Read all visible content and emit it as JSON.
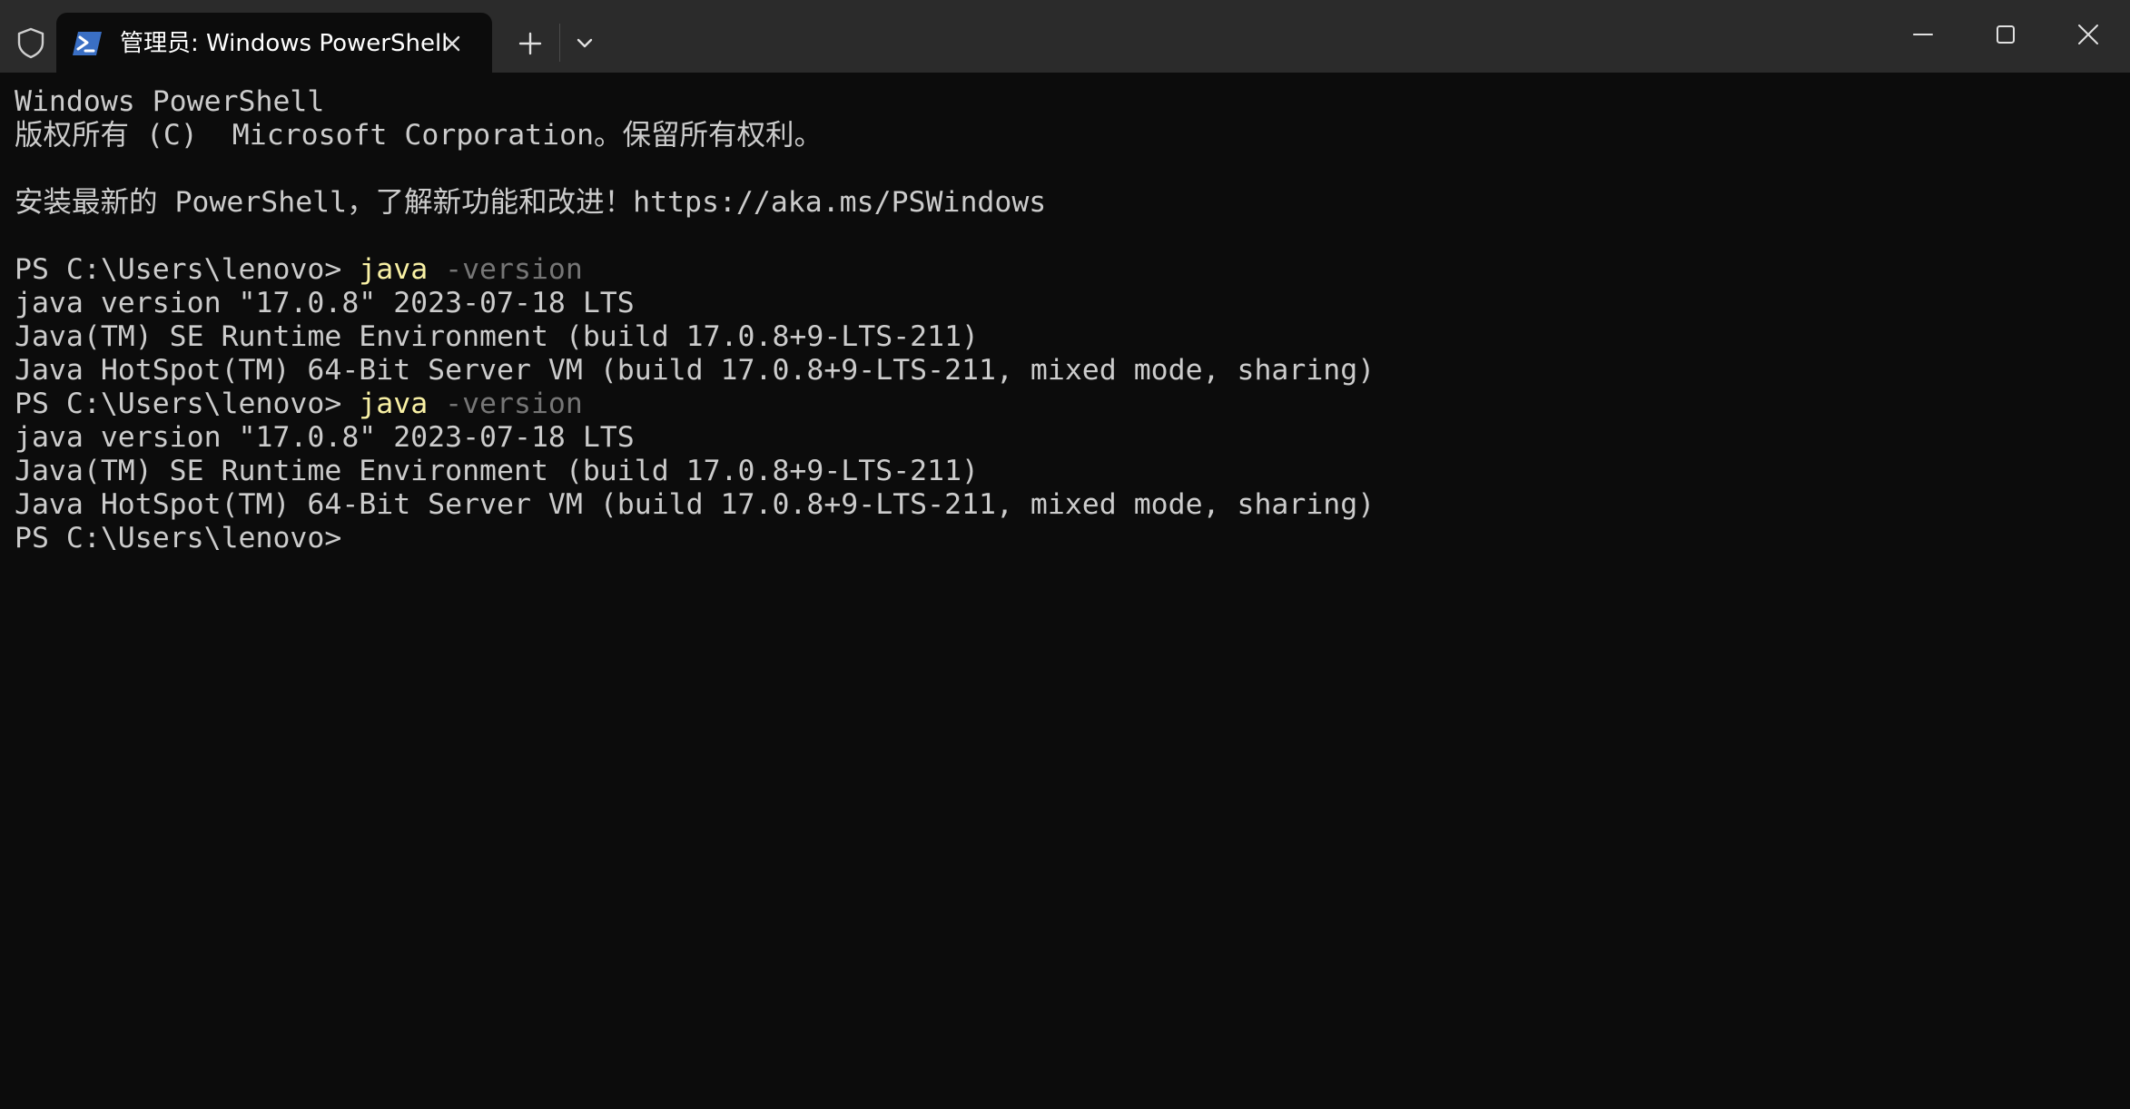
{
  "window": {
    "tab": {
      "title": "管理员: Windows PowerShell",
      "icon": "powershell-icon"
    },
    "buttons": {
      "shield": "shield-icon",
      "new_tab": "plus-icon",
      "dropdown": "chevron-down-icon",
      "minimize": "minimize-icon",
      "maximize": "maximize-icon",
      "close": "close-icon"
    }
  },
  "colors": {
    "background": "#0c0c0c",
    "titlebar": "#2b2b2b",
    "text": "#cccccc",
    "command": "#f9f1a5",
    "parameter": "#767676"
  },
  "terminal": {
    "header_line_1": "Windows PowerShell",
    "header_line_2": "版权所有 (C)  Microsoft Corporation。保留所有权利。",
    "header_line_3": "",
    "header_line_4": "安装最新的 PowerShell，了解新功能和改进！https://aka.ms/PSWindows",
    "header_line_5": "",
    "session_1": {
      "prompt": "PS C:\\Users\\lenovo> ",
      "command": "java",
      "parameter": " -version",
      "output": [
        "java version \"17.0.8\" 2023-07-18 LTS",
        "Java(TM) SE Runtime Environment (build 17.0.8+9-LTS-211)",
        "Java HotSpot(TM) 64-Bit Server VM (build 17.0.8+9-LTS-211, mixed mode, sharing)"
      ]
    },
    "session_2": {
      "prompt": "PS C:\\Users\\lenovo> ",
      "command": "java",
      "parameter": " -version",
      "output": [
        "java version \"17.0.8\" 2023-07-18 LTS",
        "Java(TM) SE Runtime Environment (build 17.0.8+9-LTS-211)",
        "Java HotSpot(TM) 64-Bit Server VM (build 17.0.8+9-LTS-211, mixed mode, sharing)"
      ]
    },
    "final_prompt": "PS C:\\Users\\lenovo>"
  }
}
